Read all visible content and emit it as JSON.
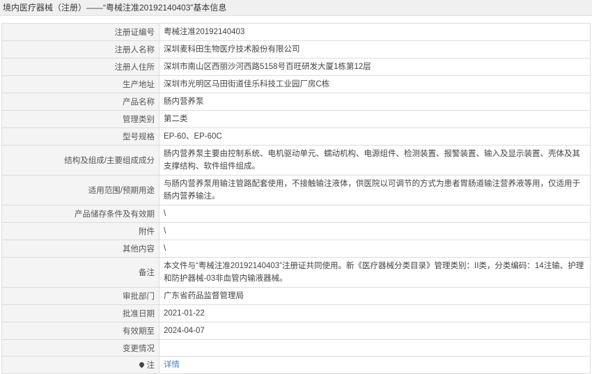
{
  "header": {
    "title": "境内医疗器械（注册）——“粤械注准20192140403”基本信息"
  },
  "rows": [
    {
      "label": "注册证编号",
      "value": "粤械注准20192140403"
    },
    {
      "label": "注册人名称",
      "value": "深圳麦科田生物医疗技术股份有限公司"
    },
    {
      "label": "注册人住所",
      "value": "深圳市南山区西丽沙河西路5158号百旺研发大厦1栋第12层"
    },
    {
      "label": "生产地址",
      "value": "深圳市光明区马田街道佳乐科技工业园厂房C栋"
    },
    {
      "label": "产品名称",
      "value": "肠内营养泵"
    },
    {
      "label": "管理类别",
      "value": "第二类"
    },
    {
      "label": "型号规格",
      "value": "EP-60、EP-60C"
    },
    {
      "label": "结构及组成/主要组成成分",
      "value": "肠内营养泵主要由控制系统、电机驱动单元、蠕动机构、电源组件、检测装置、报警装置、输入及显示装置、壳体及其支撑结构、软件组件组成。"
    },
    {
      "label": "适用范围/预期用途",
      "value": "与肠内营养泵用输注管路配套使用，不接触输注液体，供医院以可调节的方式为患者胃肠道输注营养液等用，仅适用于肠内营养输注。"
    },
    {
      "label": "产品储存条件及有效期",
      "value": "\\"
    },
    {
      "label": "附件",
      "value": "\\"
    },
    {
      "label": "其他内容",
      "value": "\\"
    },
    {
      "label": "备注",
      "value": "本文件与“粤械注准20192140403”注册证共同使用。新《医疗器械分类目录》管理类别：II类，分类编码：14注输、护理和防护器械-03非血管内输液器械。"
    },
    {
      "label": "审批部门",
      "value": "广东省药品监督管理局"
    },
    {
      "label": "批准日期",
      "value": "2021-01-22"
    },
    {
      "label": "有效期至",
      "value": "2024-04-07"
    },
    {
      "label": "变更情况",
      "value": ""
    }
  ],
  "note_row": {
    "label": "注",
    "icon": "pin-icon",
    "link": "详情"
  }
}
